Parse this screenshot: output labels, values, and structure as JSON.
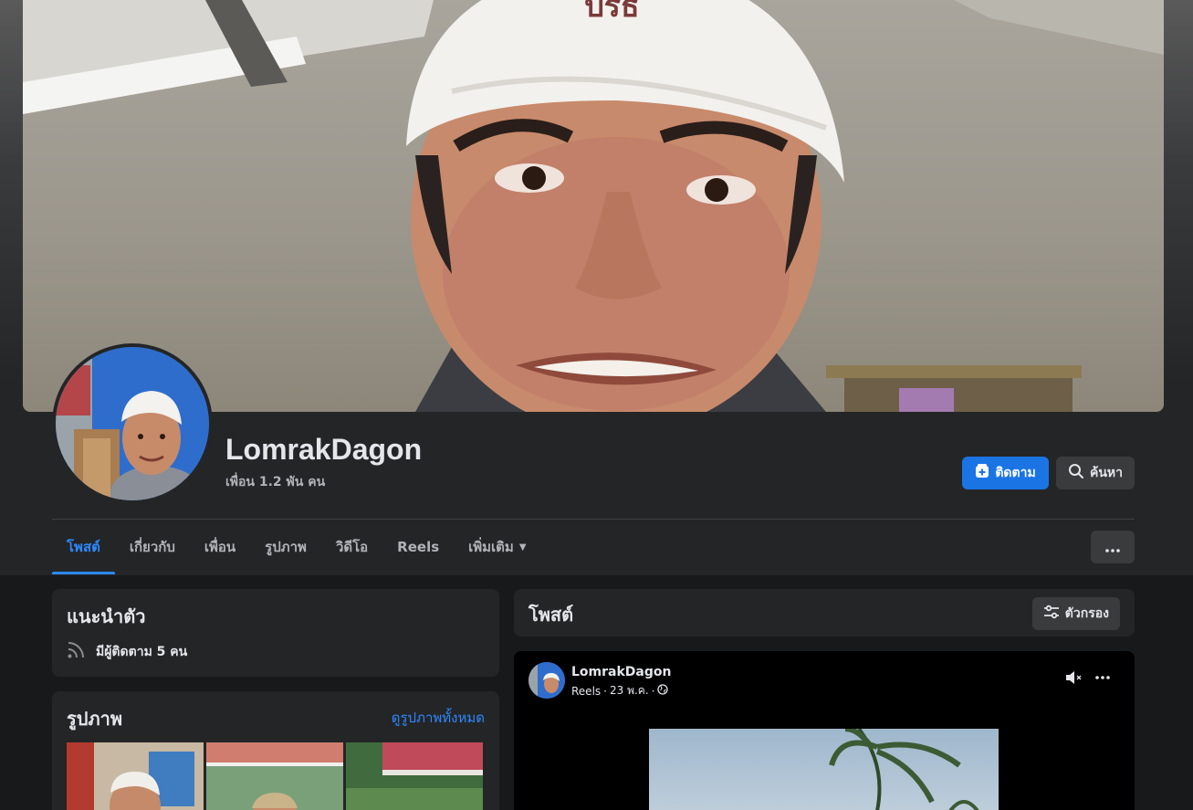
{
  "profile": {
    "name": "LomrakDagon",
    "friends": "เพื่อน 1.2 พัน คน"
  },
  "actions": {
    "follow_label": "ติดตาม",
    "search_label": "ค้นหา"
  },
  "tabs": [
    {
      "label": "โพสต์",
      "active": true
    },
    {
      "label": "เกี่ยวกับ",
      "active": false
    },
    {
      "label": "เพื่อน",
      "active": false
    },
    {
      "label": "รูปภาพ",
      "active": false
    },
    {
      "label": "วิดีโอ",
      "active": false
    },
    {
      "label": "Reels",
      "active": false
    },
    {
      "label": "เพิ่มเติม",
      "active": false
    }
  ],
  "intro": {
    "title": "แนะนำตัว",
    "followers": "มีผู้ติดตาม 5 คน"
  },
  "photos": {
    "title": "รูปภาพ",
    "see_all": "ดูรูปภาพทั้งหมด"
  },
  "posts": {
    "title": "โพสต์",
    "filter_label": "ตัวกรอง"
  },
  "post": {
    "author": "LomrakDagon",
    "type": "Reels",
    "date": "23 พ.ค."
  },
  "colors": {
    "accent": "#2d88ff",
    "follow_button": "#1b74e4",
    "card_bg": "#242526",
    "page_bg": "#18191a"
  },
  "icons": [
    "follow-icon",
    "search-icon",
    "rss-icon",
    "filter-icon",
    "mute-icon",
    "more-icon",
    "globe-icon",
    "caret-down-icon"
  ]
}
